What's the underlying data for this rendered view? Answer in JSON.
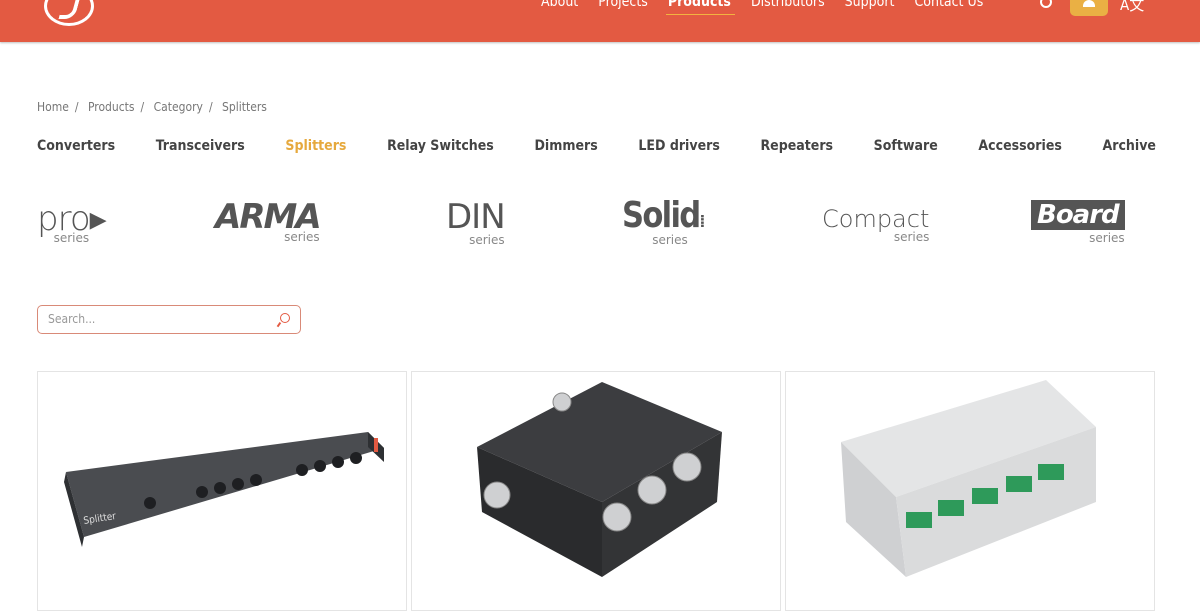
{
  "header": {
    "nav": [
      "About",
      "Projects",
      "Products",
      "Distributors",
      "Support",
      "Contact Us"
    ],
    "active": "Products",
    "lang_label": "A文",
    "brand_color": "#e35a42",
    "accent_color": "#eab044"
  },
  "breadcrumb": [
    "Home",
    "Products",
    "Category",
    "Splitters"
  ],
  "categories": [
    "Converters",
    "Transceivers",
    "Splitters",
    "Relay Switches",
    "Dimmers",
    "LED drivers",
    "Repeaters",
    "Software",
    "Accessories",
    "Archive"
  ],
  "active_category": "Splitters",
  "series": [
    {
      "name": "pro",
      "sub": "series"
    },
    {
      "name": "ARMA",
      "sub": "series"
    },
    {
      "name": "DIN",
      "sub": "series"
    },
    {
      "name": "Solid",
      "sub": "series"
    },
    {
      "name": "Compact",
      "sub": "series"
    },
    {
      "name": "Board",
      "sub": "series"
    }
  ],
  "search": {
    "placeholder": "Search..."
  },
  "products": [
    {
      "image": "rack-splitter",
      "label": "Splitter"
    },
    {
      "image": "junction-box"
    },
    {
      "image": "din-rail-module"
    }
  ]
}
